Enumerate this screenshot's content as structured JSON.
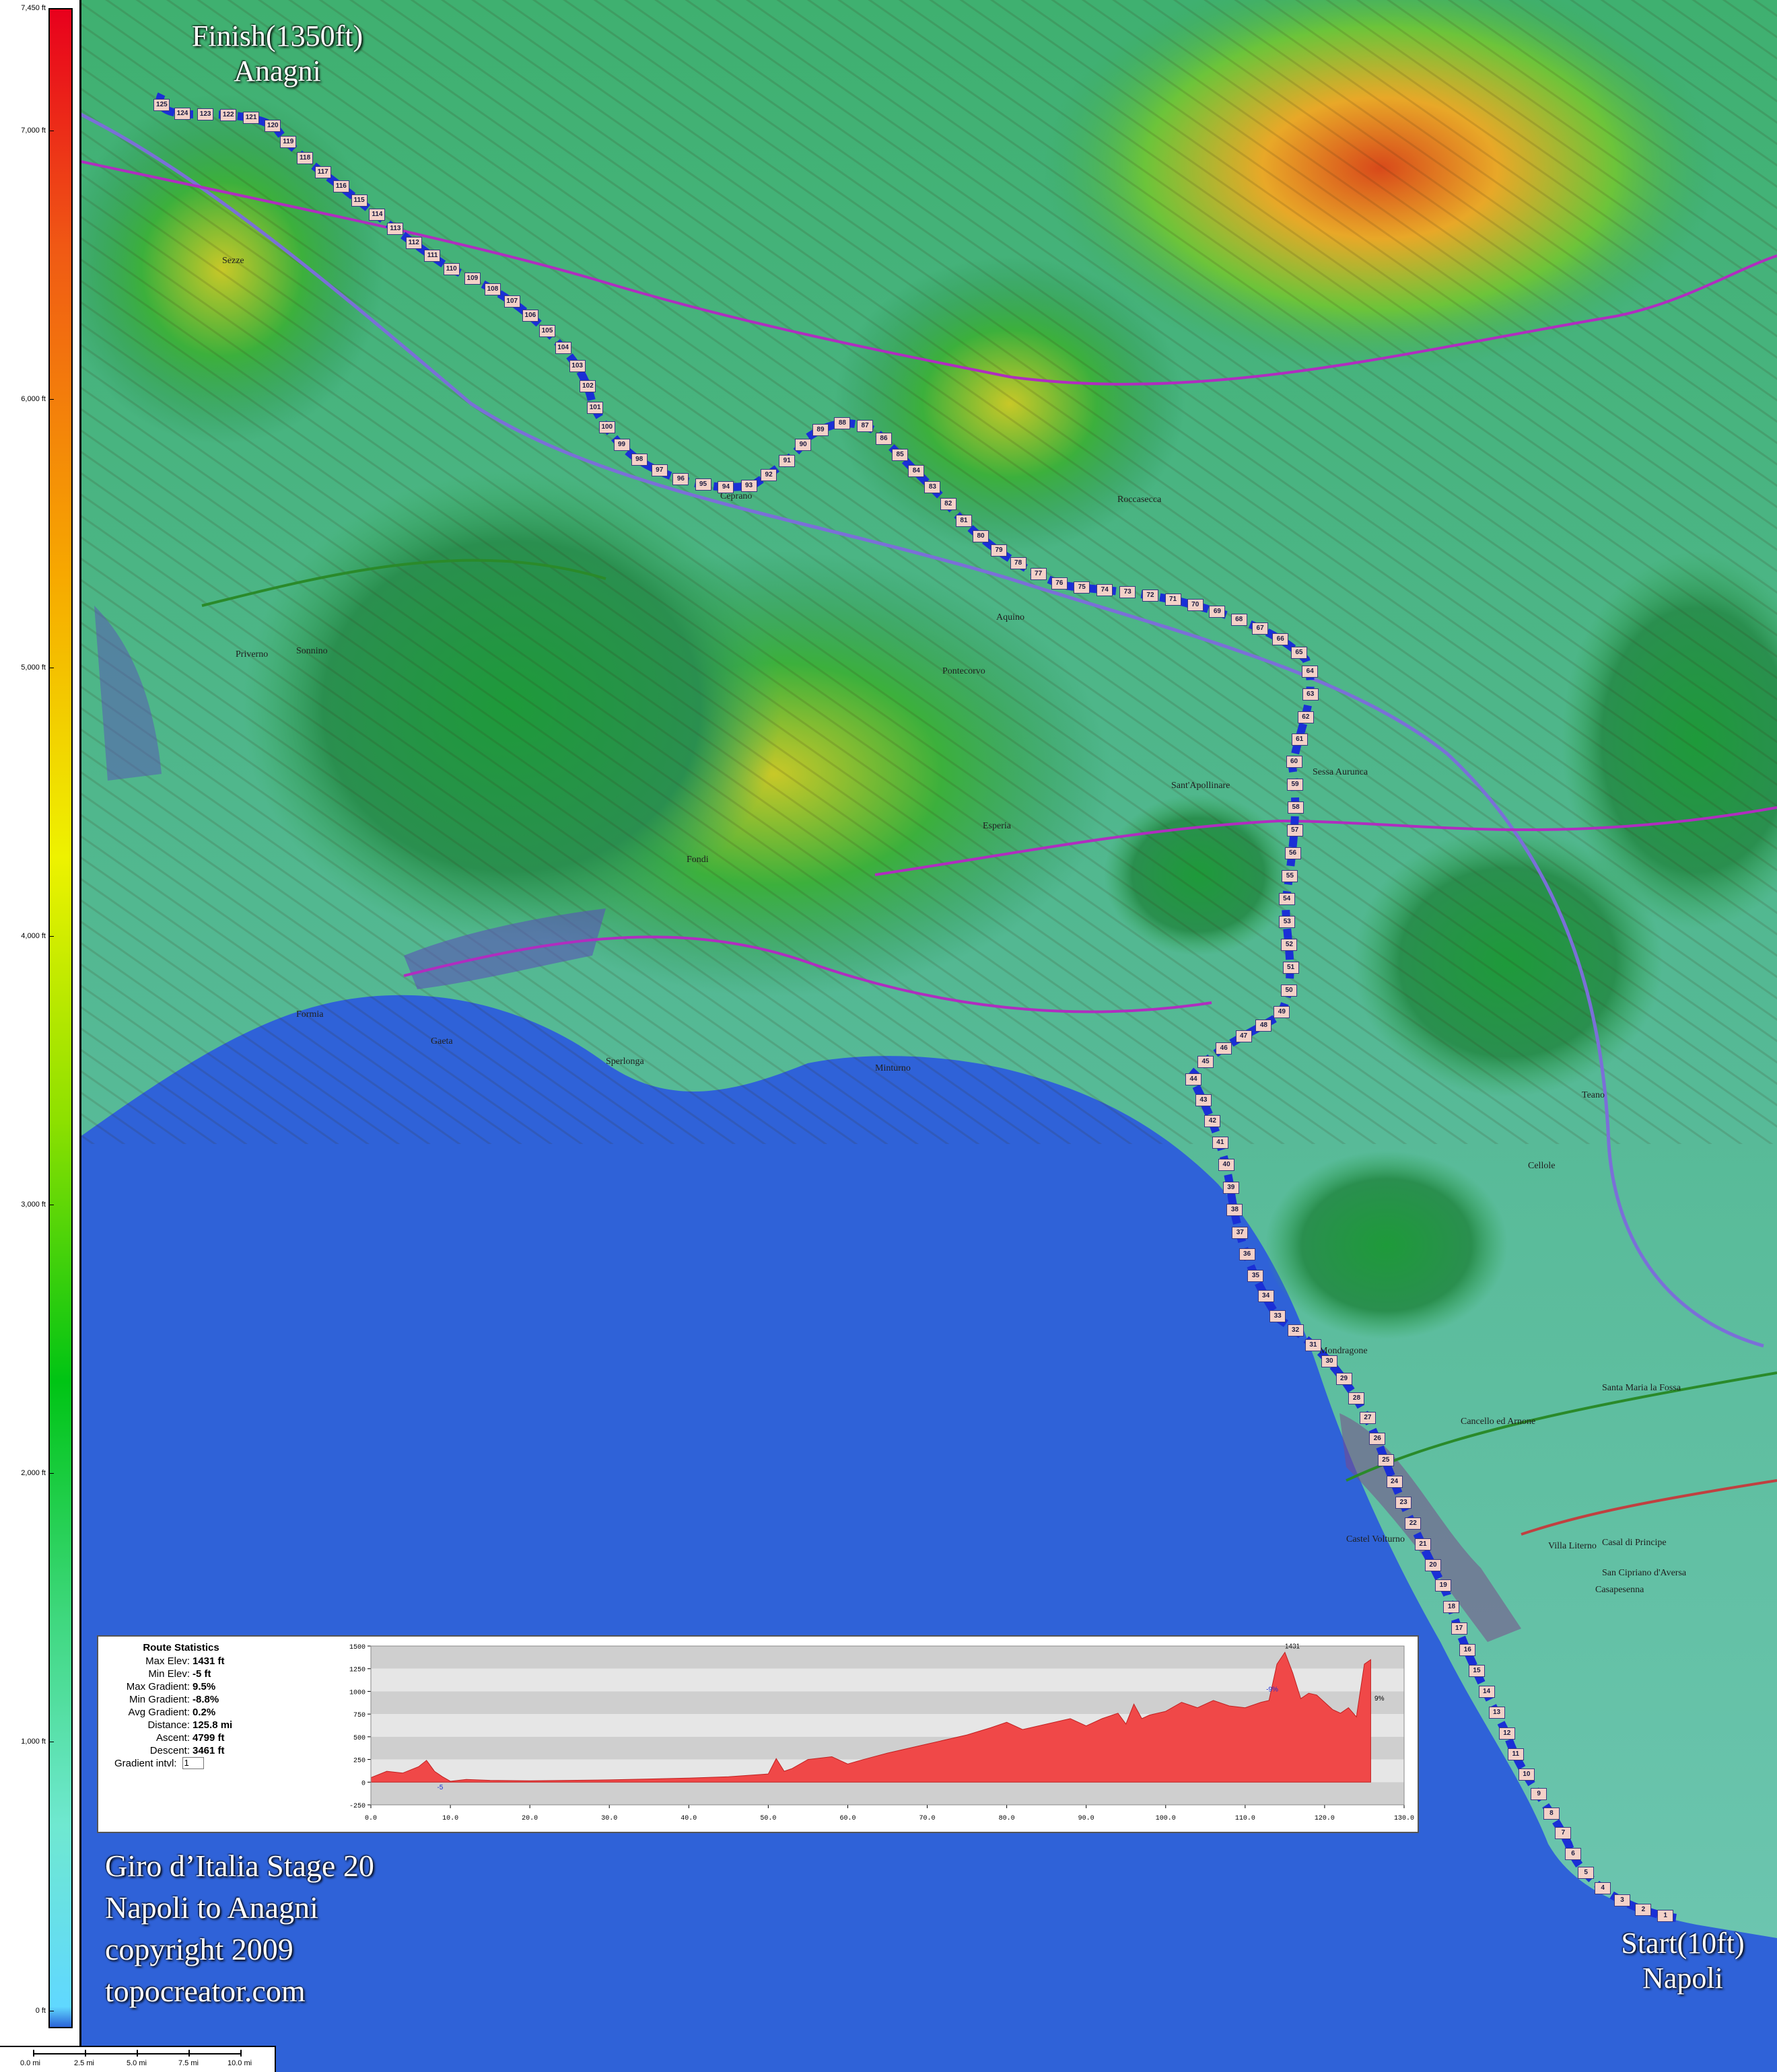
{
  "map": {
    "title_lines": [
      "Giro d’Italia Stage 20",
      "Napoli to Anagni",
      "copyright 2009",
      "topocreator.com"
    ],
    "finish_label": {
      "line1": "Finish(1350ft)",
      "line2": "Anagni"
    },
    "start_label": {
      "line1": "Start(10ft)",
      "line2": "Napoli"
    },
    "route_color": "#1a2fd6",
    "route_marker_color": "#f4d1c8",
    "sea_color": "#2f62d8",
    "road_primary_color": "#b02dbf",
    "road_secondary_color": "#2a8a2a",
    "highway_color": "#7b6fd8",
    "place_labels": [
      "Cellole",
      "Sant'Apollinare",
      "Cancello ed Arnone",
      "Santa Maria la Fossa",
      "Casal di Principe",
      "Villa Literno",
      "San Cipriano d'Aversa",
      "Casapesenna",
      "Aquino",
      "Roccasecca",
      "Ceprano",
      "Sezze",
      "Sonnino",
      "Priverno",
      "Pontecorvo",
      "Esperia",
      "Fondi",
      "Sperlonga",
      "Gaeta",
      "Formia",
      "Minturno",
      "Sessa Aurunca",
      "Teano",
      "Mondragone",
      "Castel Volturno",
      "Terracina"
    ]
  },
  "elevation_scale": {
    "unit": "ft",
    "ticks": [
      "7,450 ft",
      "7,000 ft",
      "6,000 ft",
      "5,000 ft",
      "4,000 ft",
      "3,000 ft",
      "2,000 ft",
      "1,000 ft",
      "0 ft"
    ]
  },
  "distance_scale": {
    "ticks": [
      "0.0 mi",
      "2.5 mi",
      "5.0 mi",
      "7.5 mi",
      "10.0 mi"
    ]
  },
  "route_statistics": {
    "title": "Route Statistics",
    "rows": [
      {
        "label": "Max Elev:",
        "value": "1431 ft"
      },
      {
        "label": "Min Elev:",
        "value": "-5 ft"
      },
      {
        "label": "Max Gradient:",
        "value": "9.5%"
      },
      {
        "label": "Min Gradient:",
        "value": "-8.8%"
      },
      {
        "label": "Avg Gradient:",
        "value": "0.2%"
      },
      {
        "label": "Distance:",
        "value": "125.8 mi"
      },
      {
        "label": "Ascent:",
        "value": "4799 ft"
      },
      {
        "label": "Descent:",
        "value": "3461 ft"
      }
    ],
    "gradient_interval_label": "Gradient intvl:",
    "gradient_interval_value": "1"
  },
  "chart_data": {
    "type": "area",
    "x": [
      0,
      2,
      4,
      6,
      7,
      8,
      9,
      10,
      12,
      15,
      20,
      25,
      30,
      35,
      40,
      45,
      50,
      51,
      52,
      53,
      55,
      58,
      60,
      62,
      65,
      70,
      75,
      78,
      80,
      82,
      85,
      88,
      90,
      92,
      94,
      95,
      96,
      97,
      98,
      100,
      102,
      104,
      106,
      108,
      110,
      112,
      113,
      114,
      115,
      116,
      117,
      118,
      119,
      120,
      121,
      122,
      123,
      124,
      125,
      125.8
    ],
    "y": [
      50,
      120,
      100,
      170,
      240,
      120,
      60,
      10,
      30,
      20,
      15,
      20,
      25,
      35,
      45,
      60,
      90,
      260,
      120,
      150,
      250,
      280,
      200,
      250,
      320,
      420,
      520,
      600,
      660,
      580,
      640,
      700,
      620,
      700,
      760,
      640,
      860,
      700,
      740,
      780,
      880,
      820,
      900,
      840,
      820,
      880,
      900,
      1300,
      1431,
      1200,
      920,
      980,
      960,
      880,
      800,
      760,
      820,
      720,
      1300,
      1350
    ],
    "xlim": [
      0,
      130
    ],
    "ylim": [
      -250,
      1500
    ],
    "x_ticks": [
      "0.0",
      "10.0",
      "20.0",
      "30.0",
      "40.0",
      "50.0",
      "60.0",
      "70.0",
      "80.0",
      "90.0",
      "100.0",
      "110.0",
      "120.0",
      "130.0"
    ],
    "y_ticks": [
      "1500",
      "1250",
      "1000",
      "750",
      "500",
      "250",
      "0",
      "-250"
    ],
    "annotations": [
      "1431",
      "-9%",
      "-5",
      "9%"
    ],
    "fill_color": "#f04848",
    "grid": true
  },
  "route_markers": [
    "1",
    "2",
    "3",
    "4",
    "5",
    "6",
    "7",
    "8",
    "9",
    "10",
    "11",
    "12",
    "13",
    "14",
    "15",
    "16",
    "17",
    "18",
    "19",
    "20",
    "21",
    "22",
    "23",
    "24",
    "25",
    "26",
    "27",
    "28",
    "29",
    "30",
    "31",
    "32",
    "33",
    "34",
    "35",
    "36",
    "37",
    "38",
    "39",
    "40",
    "41",
    "42",
    "43",
    "44",
    "45",
    "46",
    "47",
    "48",
    "49",
    "50",
    "51",
    "52",
    "53",
    "54",
    "55",
    "56",
    "57",
    "58",
    "59",
    "60",
    "61",
    "62",
    "63",
    "64",
    "65",
    "66",
    "67",
    "68",
    "69",
    "70",
    "71",
    "72",
    "73",
    "74",
    "75",
    "76",
    "77",
    "78",
    "79",
    "80",
    "81",
    "82",
    "83",
    "84",
    "85",
    "86",
    "87",
    "88",
    "89",
    "90",
    "91",
    "92",
    "93",
    "94",
    "95",
    "96",
    "97",
    "98",
    "99",
    "100",
    "101",
    "102",
    "103",
    "104",
    "105",
    "106",
    "107",
    "108",
    "109",
    "110",
    "111",
    "112",
    "113",
    "114",
    "115",
    "116",
    "117",
    "118",
    "119",
    "120",
    "121",
    "122",
    "123",
    "124",
    "125"
  ]
}
